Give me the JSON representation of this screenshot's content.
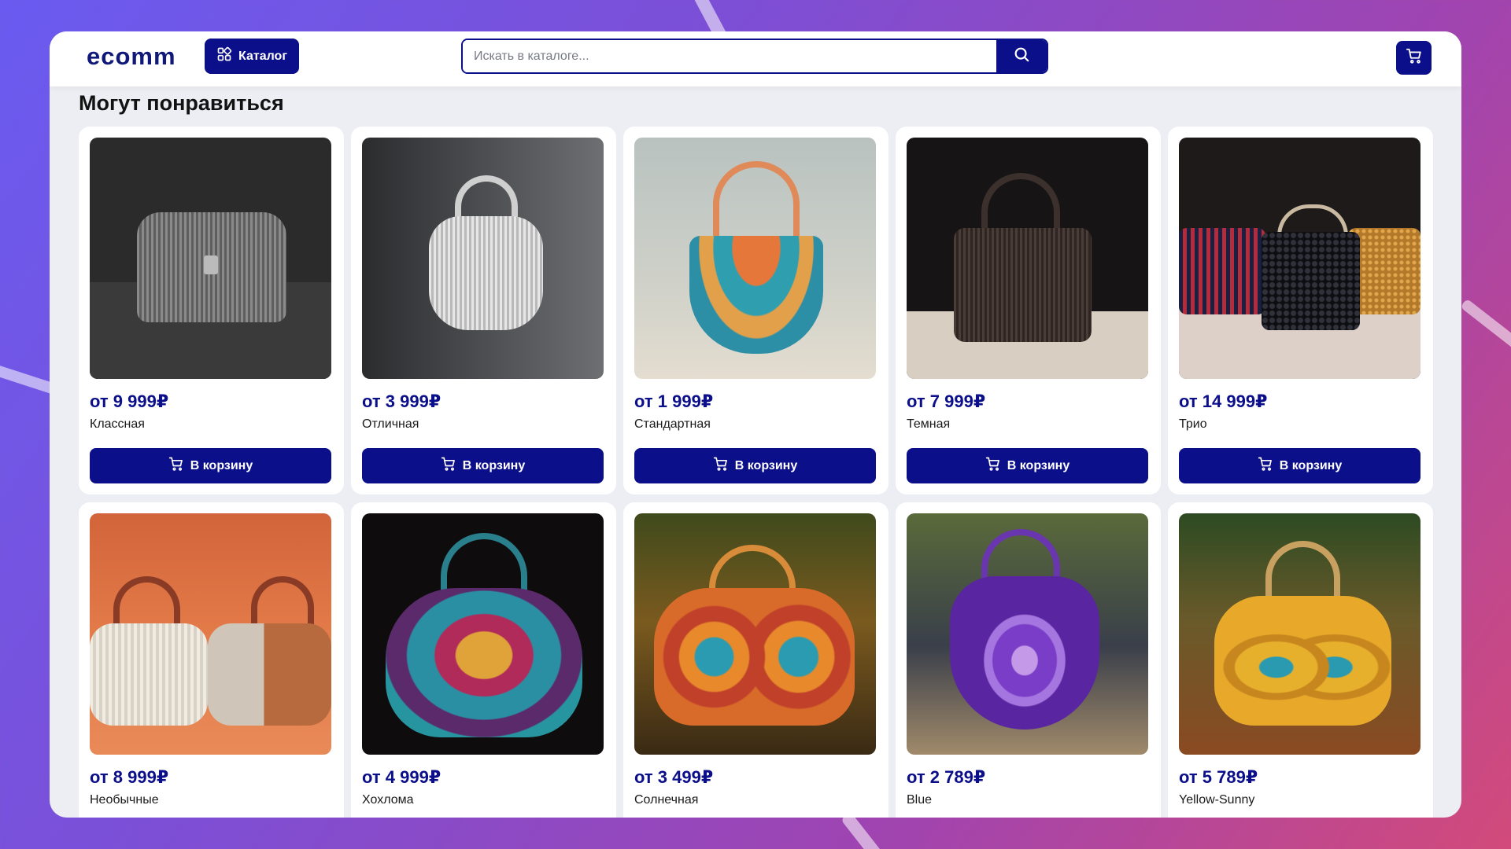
{
  "header": {
    "logo": "ecomm",
    "catalog_label": "Каталог",
    "search_placeholder": "Искать в каталоге...",
    "search_value": ""
  },
  "section_title": "Могут понравиться",
  "add_to_cart_label": "В корзину",
  "colors": {
    "brand": "#0b0f8a",
    "page_bg": "#eceef3"
  },
  "icons": {
    "catalog": "grid-icon",
    "search": "search-icon",
    "cart": "cart-icon"
  },
  "products": [
    {
      "price": "от 9 999₽",
      "name": "Классная"
    },
    {
      "price": "от 3 999₽",
      "name": "Отличная"
    },
    {
      "price": "от 1 999₽",
      "name": "Стандартная"
    },
    {
      "price": "от 7 999₽",
      "name": "Темная"
    },
    {
      "price": "от 14 999₽",
      "name": "Трио"
    },
    {
      "price": "от 8 999₽",
      "name": "Необычные"
    },
    {
      "price": "от 4 999₽",
      "name": "Хохлома"
    },
    {
      "price": "от 3 499₽",
      "name": "Солнечная"
    },
    {
      "price": "от 2 789₽",
      "name": "Blue"
    },
    {
      "price": "от 5 789₽",
      "name": "Yellow-Sunny"
    }
  ]
}
